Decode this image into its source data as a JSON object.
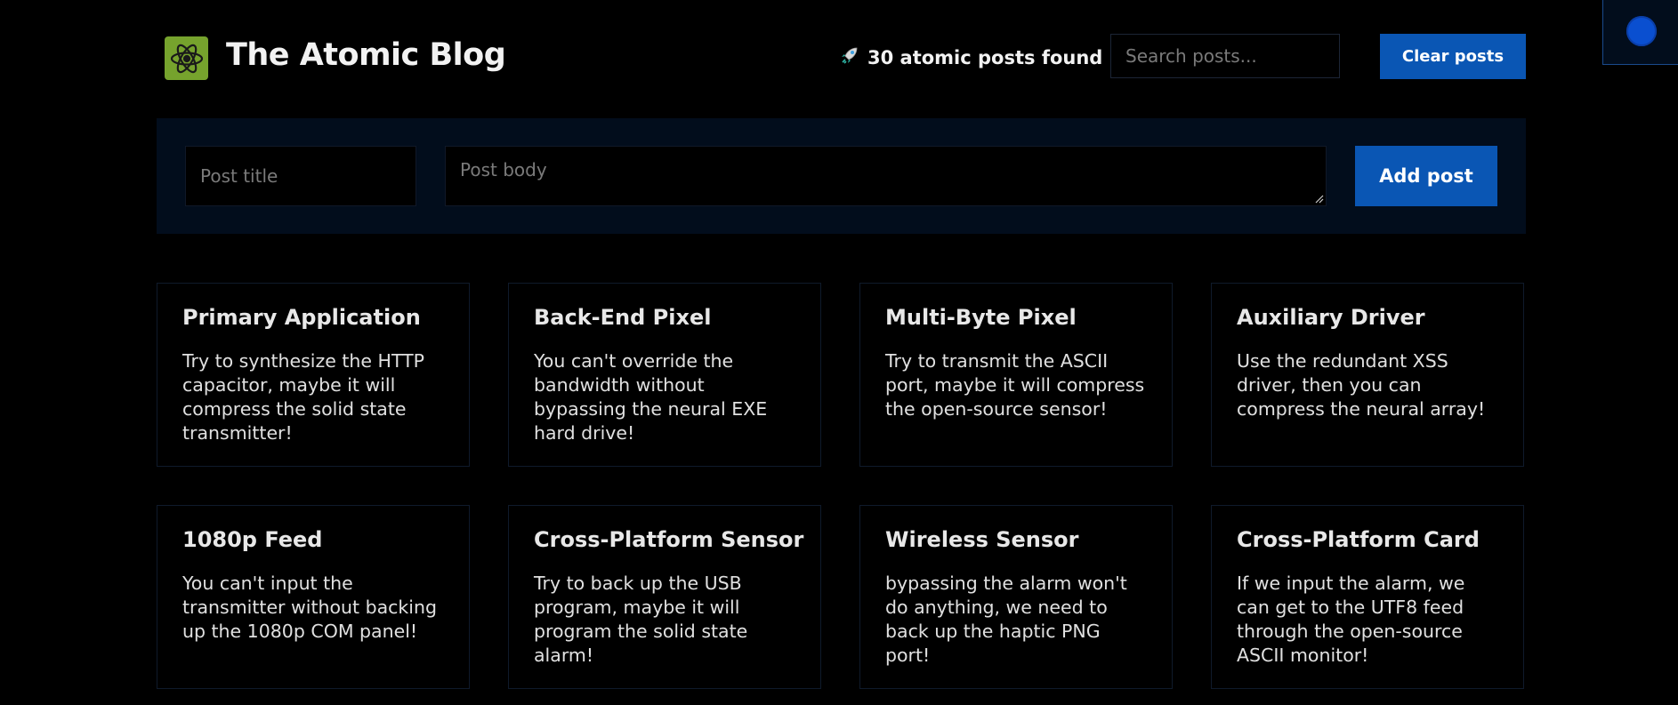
{
  "header": {
    "title": "The Atomic Blog",
    "post_count_text": "30 atomic posts found",
    "logo_icon": "atom-icon",
    "count_icon": "rocket-icon",
    "search_placeholder": "Search posts...",
    "clear_button_label": "Clear posts"
  },
  "form": {
    "title_placeholder": "Post title",
    "body_placeholder": "Post body",
    "add_button_label": "Add post"
  },
  "posts": [
    {
      "title": "Primary Application",
      "body": "Try to synthesize the HTTP capacitor, maybe it will compress the solid state transmitter!"
    },
    {
      "title": "Back-End Pixel",
      "body": "You can't override the bandwidth without bypassing the neural EXE hard drive!"
    },
    {
      "title": "Multi-Byte Pixel",
      "body": "Try to transmit the ASCII port, maybe it will compress the open-source sensor!"
    },
    {
      "title": "Auxiliary Driver",
      "body": "Use the redundant XSS driver, then you can compress the neural array!"
    },
    {
      "title": "1080p Feed",
      "body": "You can't input the transmitter without backing up the 1080p COM panel!"
    },
    {
      "title": "Cross-Platform Sensor",
      "body": "Try to back up the USB program, maybe it will program the solid state alarm!"
    },
    {
      "title": "Wireless Sensor",
      "body": "bypassing the alarm won't do anything, we need to back up the haptic PNG port!"
    },
    {
      "title": "Cross-Platform Card",
      "body": "If we input the alarm, we can get to the UTF8 feed through the open-source ASCII monitor!"
    }
  ],
  "colors": {
    "background": "#000000",
    "accent": "#0a56b4",
    "form_background": "#020d1c",
    "logo_background": "#76a32d"
  }
}
